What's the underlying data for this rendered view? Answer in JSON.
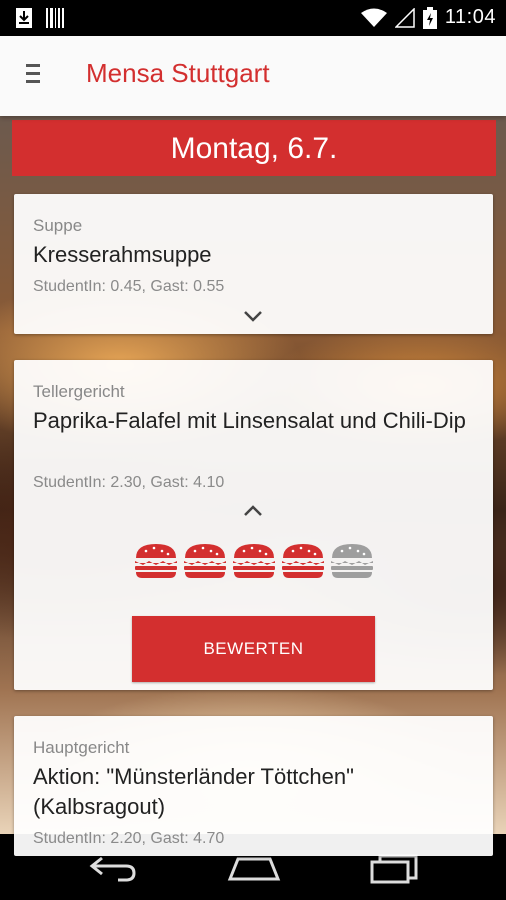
{
  "status_bar": {
    "time": "11:04"
  },
  "app_bar": {
    "title": "Mensa Stuttgart"
  },
  "date_banner": {
    "label": "Montag, 6.7."
  },
  "meals": [
    {
      "category": "Suppe",
      "name": "Kresserahmsuppe",
      "price": "StudentIn: 0.45, Gast: 0.55"
    },
    {
      "category": "Tellergericht",
      "name": "Paprika-Falafel mit Linsensalat und Chili-Dip",
      "price": "StudentIn: 2.30, Gast: 4.10",
      "rating": {
        "value": 4,
        "max": 5
      },
      "rate_button": "BEWERTEN"
    },
    {
      "category": "Hauptgericht",
      "name": "Aktion: \"Münsterländer Töttchen\" (Kalbsragout)",
      "price": "StudentIn: 2.20, Gast: 4.70"
    }
  ],
  "colors": {
    "accent": "#d32f2f",
    "rating_active": "#d32f2f",
    "rating_inactive": "#9e9e9e"
  },
  "icons": [
    "download-icon",
    "barcode-icon",
    "wifi-icon",
    "signal-icon",
    "battery-icon",
    "menu-icon",
    "chevron-down-icon",
    "chevron-up-icon",
    "burger-icon",
    "back-icon",
    "home-icon",
    "recents-icon"
  ]
}
